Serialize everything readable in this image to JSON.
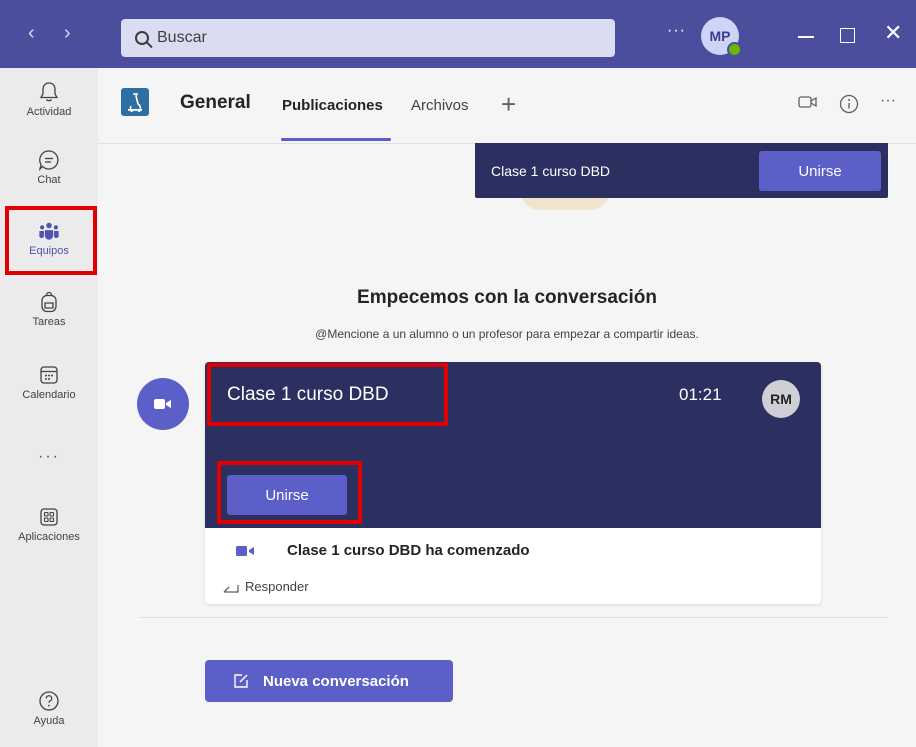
{
  "search": {
    "placeholder": "Buscar"
  },
  "titlebar": {
    "more": "···",
    "user_initials": "MP"
  },
  "rail": {
    "items": [
      {
        "label": "Actividad"
      },
      {
        "label": "Chat"
      },
      {
        "label": "Equipos"
      },
      {
        "label": "Tareas"
      },
      {
        "label": "Calendario"
      },
      {
        "label": "Aplicaciones"
      },
      {
        "label": "Ayuda"
      }
    ],
    "more": "···"
  },
  "channel": {
    "name": "General",
    "tabs": [
      {
        "label": "Publicaciones"
      },
      {
        "label": "Archivos"
      }
    ],
    "add_tab": "+"
  },
  "banner": {
    "title": "Clase 1 curso DBD",
    "button": "Unirse"
  },
  "empty_state": {
    "title": "Empecemos con la conversación",
    "subtitle": "@Mencione a un alumno o un profesor para empezar a compartir ideas."
  },
  "meeting_card": {
    "title": "Clase 1 curso DBD",
    "time": "01:21",
    "avatar_initials": "RM",
    "join_button": "Unirse",
    "status": "Clase 1 curso DBD ha comenzado",
    "reply": "Responder"
  },
  "new_conversation": {
    "label": "Nueva conversación"
  },
  "colors": {
    "brand": "#5b5fc7",
    "titlebar": "#4b4e9d",
    "meeting": "#2b3060",
    "highlight": "#e00000"
  }
}
